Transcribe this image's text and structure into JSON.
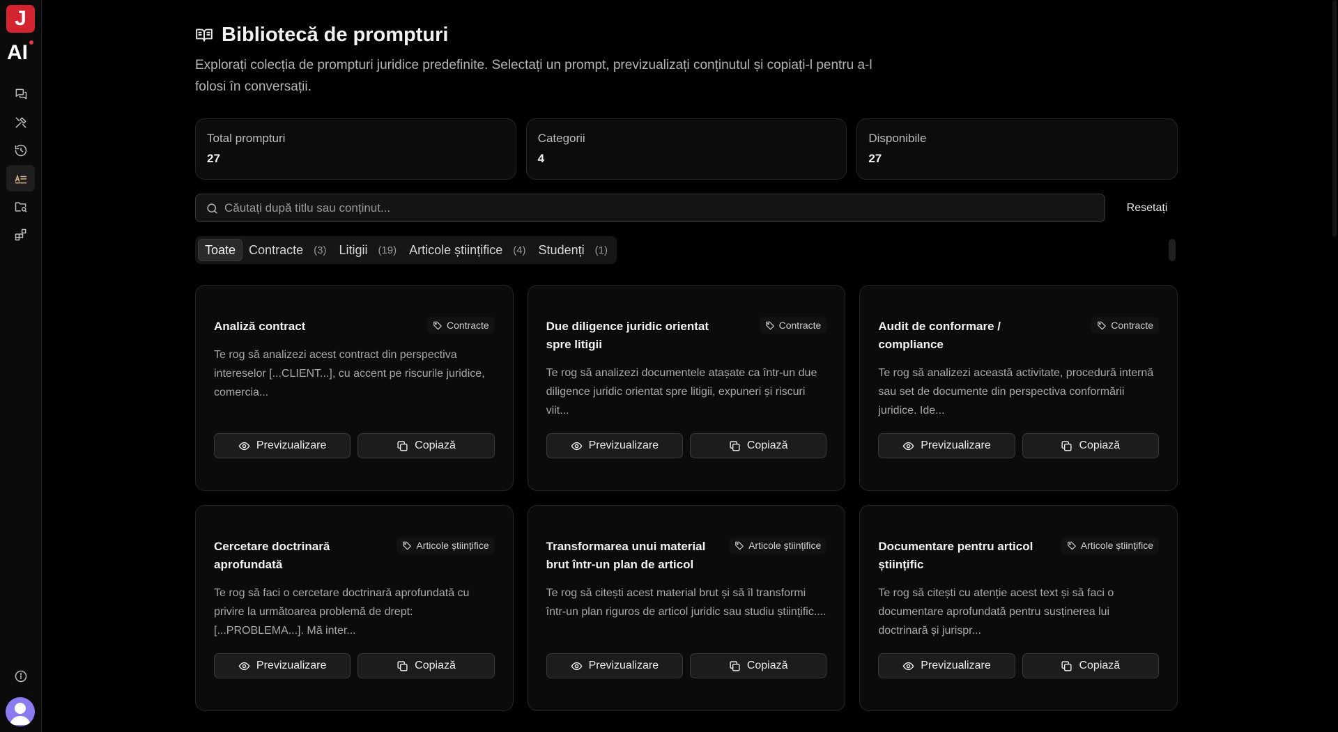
{
  "sidebar": {
    "logo_letter": "J",
    "logo_ai": "AI",
    "nav": [
      {
        "icon": "chat-icon"
      },
      {
        "icon": "tools-icon"
      },
      {
        "icon": "history-icon"
      },
      {
        "icon": "prompt-library-icon",
        "active": true
      },
      {
        "icon": "folder-search-icon"
      },
      {
        "icon": "apps-icon"
      }
    ],
    "info_icon": "info-icon",
    "avatar_icon": "user-avatar-icon"
  },
  "header": {
    "title": "Bibliotecă de prompturi",
    "subtitle": "Explorați colecția de prompturi juridice predefinite. Selectați un prompt, previzualizați conținutul și copiați-l pentru a-l folosi în conversații."
  },
  "stats": [
    {
      "label": "Total prompturi",
      "value": "27"
    },
    {
      "label": "Categorii",
      "value": "4"
    },
    {
      "label": "Disponibile",
      "value": "27"
    }
  ],
  "search": {
    "placeholder": "Căutați după titlu sau conținut...",
    "value": "",
    "reset_label": "Resetați"
  },
  "tabs": [
    {
      "label": "Toate",
      "count": "",
      "active": true
    },
    {
      "label": "Contracte",
      "count": "(3)"
    },
    {
      "label": "Litigii",
      "count": "(19)"
    },
    {
      "label": "Articole științifice",
      "count": "(4)"
    },
    {
      "label": "Studenți",
      "count": "(1)"
    }
  ],
  "actions": {
    "preview_label": "Previzualizare",
    "copy_label": "Copiază"
  },
  "cards": [
    {
      "title": "Analiză contract",
      "tag": "Contracte",
      "description": "Te rog să analizezi acest contract din perspectiva intereselor [...CLIENT...], cu accent pe riscurile juridice, comercia..."
    },
    {
      "title": "Due diligence juridic orientat spre litigii",
      "tag": "Contracte",
      "description": "Te rog să analizezi documentele atașate ca într-un due diligence juridic orientat spre litigii, expuneri și riscuri viit..."
    },
    {
      "title": "Audit de conformare / compliance",
      "tag": "Contracte",
      "description": "Te rog să analizezi această activitate, procedură internă sau set de documente din perspectiva conformării juridice. Ide..."
    },
    {
      "title": "Cercetare doctrinară aprofundată",
      "tag": "Articole științifice",
      "description": "Te rog să faci o cercetare doctrinară aprofundată cu privire la următoarea problemă de drept: [...PROBLEMA...]. Mă inter..."
    },
    {
      "title": "Transformarea unui material brut într-un plan de articol",
      "tag": "Articole științifice",
      "description": "Te rog să citești acest material brut și să îl transformi într-un plan riguros de articol juridic sau studiu științific...."
    },
    {
      "title": "Documentare pentru articol științific",
      "tag": "Articole științifice",
      "description": "Te rog să citești cu atenție acest text și să faci o documentare aprofundată pentru susținerea lui doctrinară și jurispr..."
    }
  ]
}
